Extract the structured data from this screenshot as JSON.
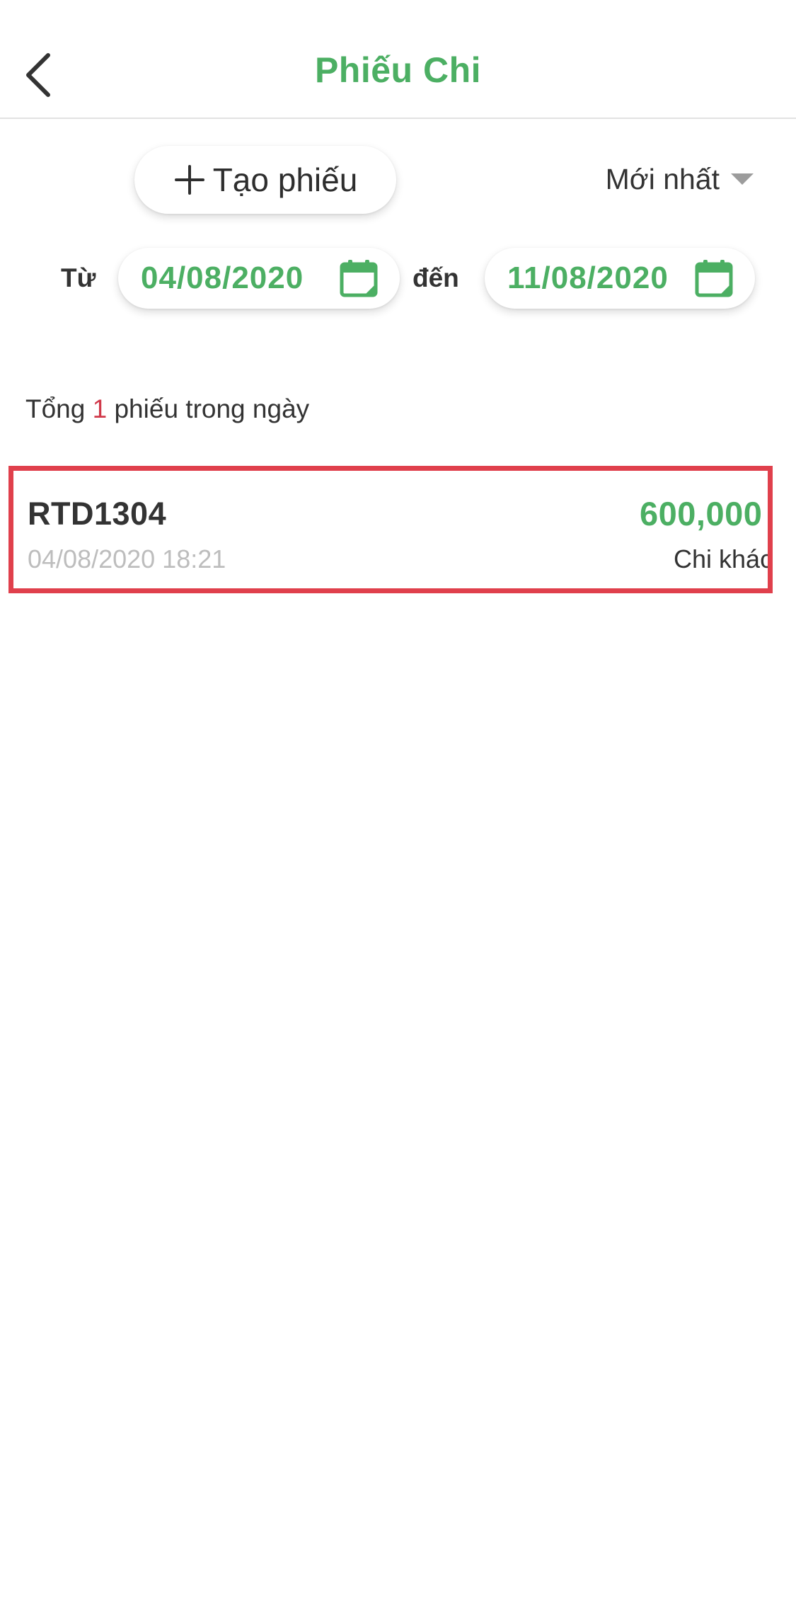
{
  "header": {
    "title": "Phiếu Chi",
    "back_icon": "chevron-left-icon"
  },
  "toolbar": {
    "create_label": "Tạo phiếu",
    "create_icon": "plus-icon",
    "sort_label": "Mới nhất",
    "sort_icon": "caret-down-icon"
  },
  "date_range": {
    "from_label": "Từ",
    "from_value": "04/08/2020",
    "to_label": "đến",
    "to_value": "11/08/2020",
    "icon": "calendar-icon"
  },
  "summary": {
    "prefix": "Tổng",
    "count": "1",
    "suffix": "phiếu trong ngày"
  },
  "vouchers": [
    {
      "code": "RTD1304",
      "datetime": "04/08/2020 18:21",
      "amount": "600,000",
      "category": "Chi khác"
    }
  ],
  "colors": {
    "accent_green": "#4caf63",
    "count_red": "#d0394a",
    "highlight_border": "#e0404c",
    "muted_text": "#bdbdbd"
  }
}
